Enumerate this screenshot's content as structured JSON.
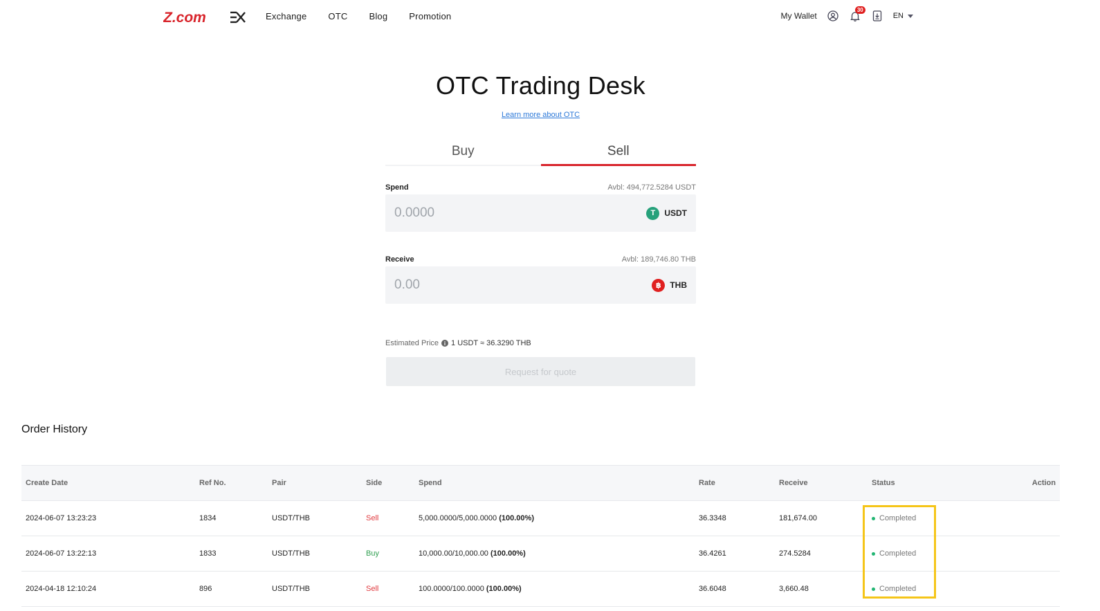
{
  "header": {
    "logo_text": "Z.comEX",
    "nav": [
      "Exchange",
      "OTC",
      "Blog",
      "Promotion"
    ],
    "wallet_label": "My Wallet",
    "notification_count": "30",
    "language": "EN",
    "icons": [
      "user-icon",
      "bell-icon",
      "download-icon",
      "chevron-down-icon"
    ]
  },
  "main": {
    "title": "OTC Trading Desk",
    "learn_more": "Learn more about OTC",
    "tabs": [
      {
        "label": "Buy",
        "active": false
      },
      {
        "label": "Sell",
        "active": true
      }
    ],
    "spend": {
      "label": "Spend",
      "avbl": "Avbl: 494,772.5284 USDT",
      "placeholder": "0.0000",
      "currency": "USDT",
      "currency_icon": "T",
      "currency_color": "#26a17b"
    },
    "receive": {
      "label": "Receive",
      "avbl": "Avbl: 189,746.80 THB",
      "placeholder": "0.00",
      "currency": "THB",
      "currency_icon": "฿",
      "currency_color": "#e02020"
    },
    "estimated_price_label": "Estimated Price",
    "estimated_price_value": "1 USDT ≈ 36.3290 THB",
    "quote_button": "Request for quote"
  },
  "order_history": {
    "title": "Order History",
    "columns": [
      "Create Date",
      "Ref No.",
      "Pair",
      "Side",
      "Spend",
      "Rate",
      "Receive",
      "Status",
      "Action"
    ],
    "rows": [
      {
        "date": "2024-06-07 13:23:23",
        "ref": "1834",
        "pair": "USDT/THB",
        "side": "Sell",
        "spend": "5,000.0000/5,000.0000",
        "pct": "(100.00%)",
        "rate": "36.3348",
        "receive": "181,674.00",
        "status": "Completed"
      },
      {
        "date": "2024-06-07 13:22:13",
        "ref": "1833",
        "pair": "USDT/THB",
        "side": "Buy",
        "spend": "10,000.00/10,000.00",
        "pct": "(100.00%)",
        "rate": "36.4261",
        "receive": "274.5284",
        "status": "Completed"
      },
      {
        "date": "2024-04-18 12:10:24",
        "ref": "896",
        "pair": "USDT/THB",
        "side": "Sell",
        "spend": "100.0000/100.0000",
        "pct": "(100.00%)",
        "rate": "36.6048",
        "receive": "3,660.48",
        "status": "Completed"
      }
    ]
  },
  "colors": {
    "brand_red": "#d8232a",
    "highlight": "#f5c518",
    "status_green": "#22b573"
  }
}
